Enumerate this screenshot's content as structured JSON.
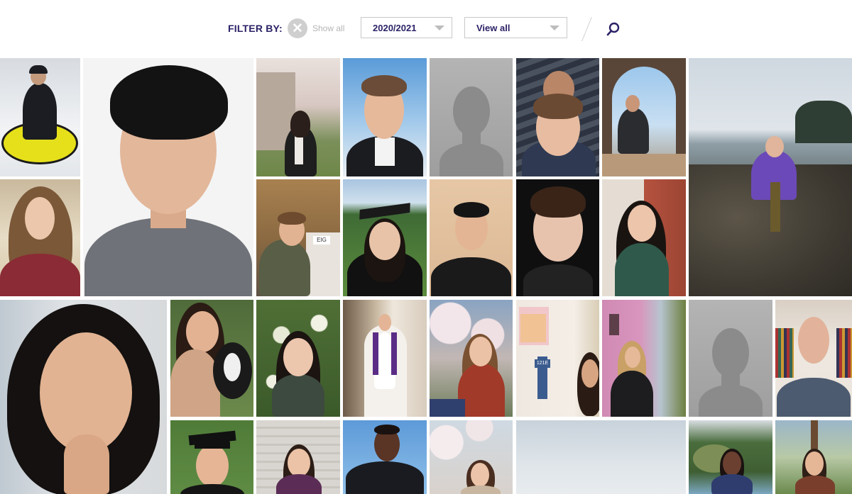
{
  "filter": {
    "label": "FILTER BY:",
    "clear_icon": "close-icon",
    "show_all": "Show all",
    "year_select": "2020/2021",
    "view_select": "View all",
    "search_icon": "search-icon"
  },
  "tile_text": {
    "door_sign": "EIG",
    "room_label": "121E"
  },
  "colors": {
    "brand": "#2b2367",
    "placeholder_bg": "#a8a8a8",
    "placeholder_silhouette": "#8b8b8b"
  }
}
